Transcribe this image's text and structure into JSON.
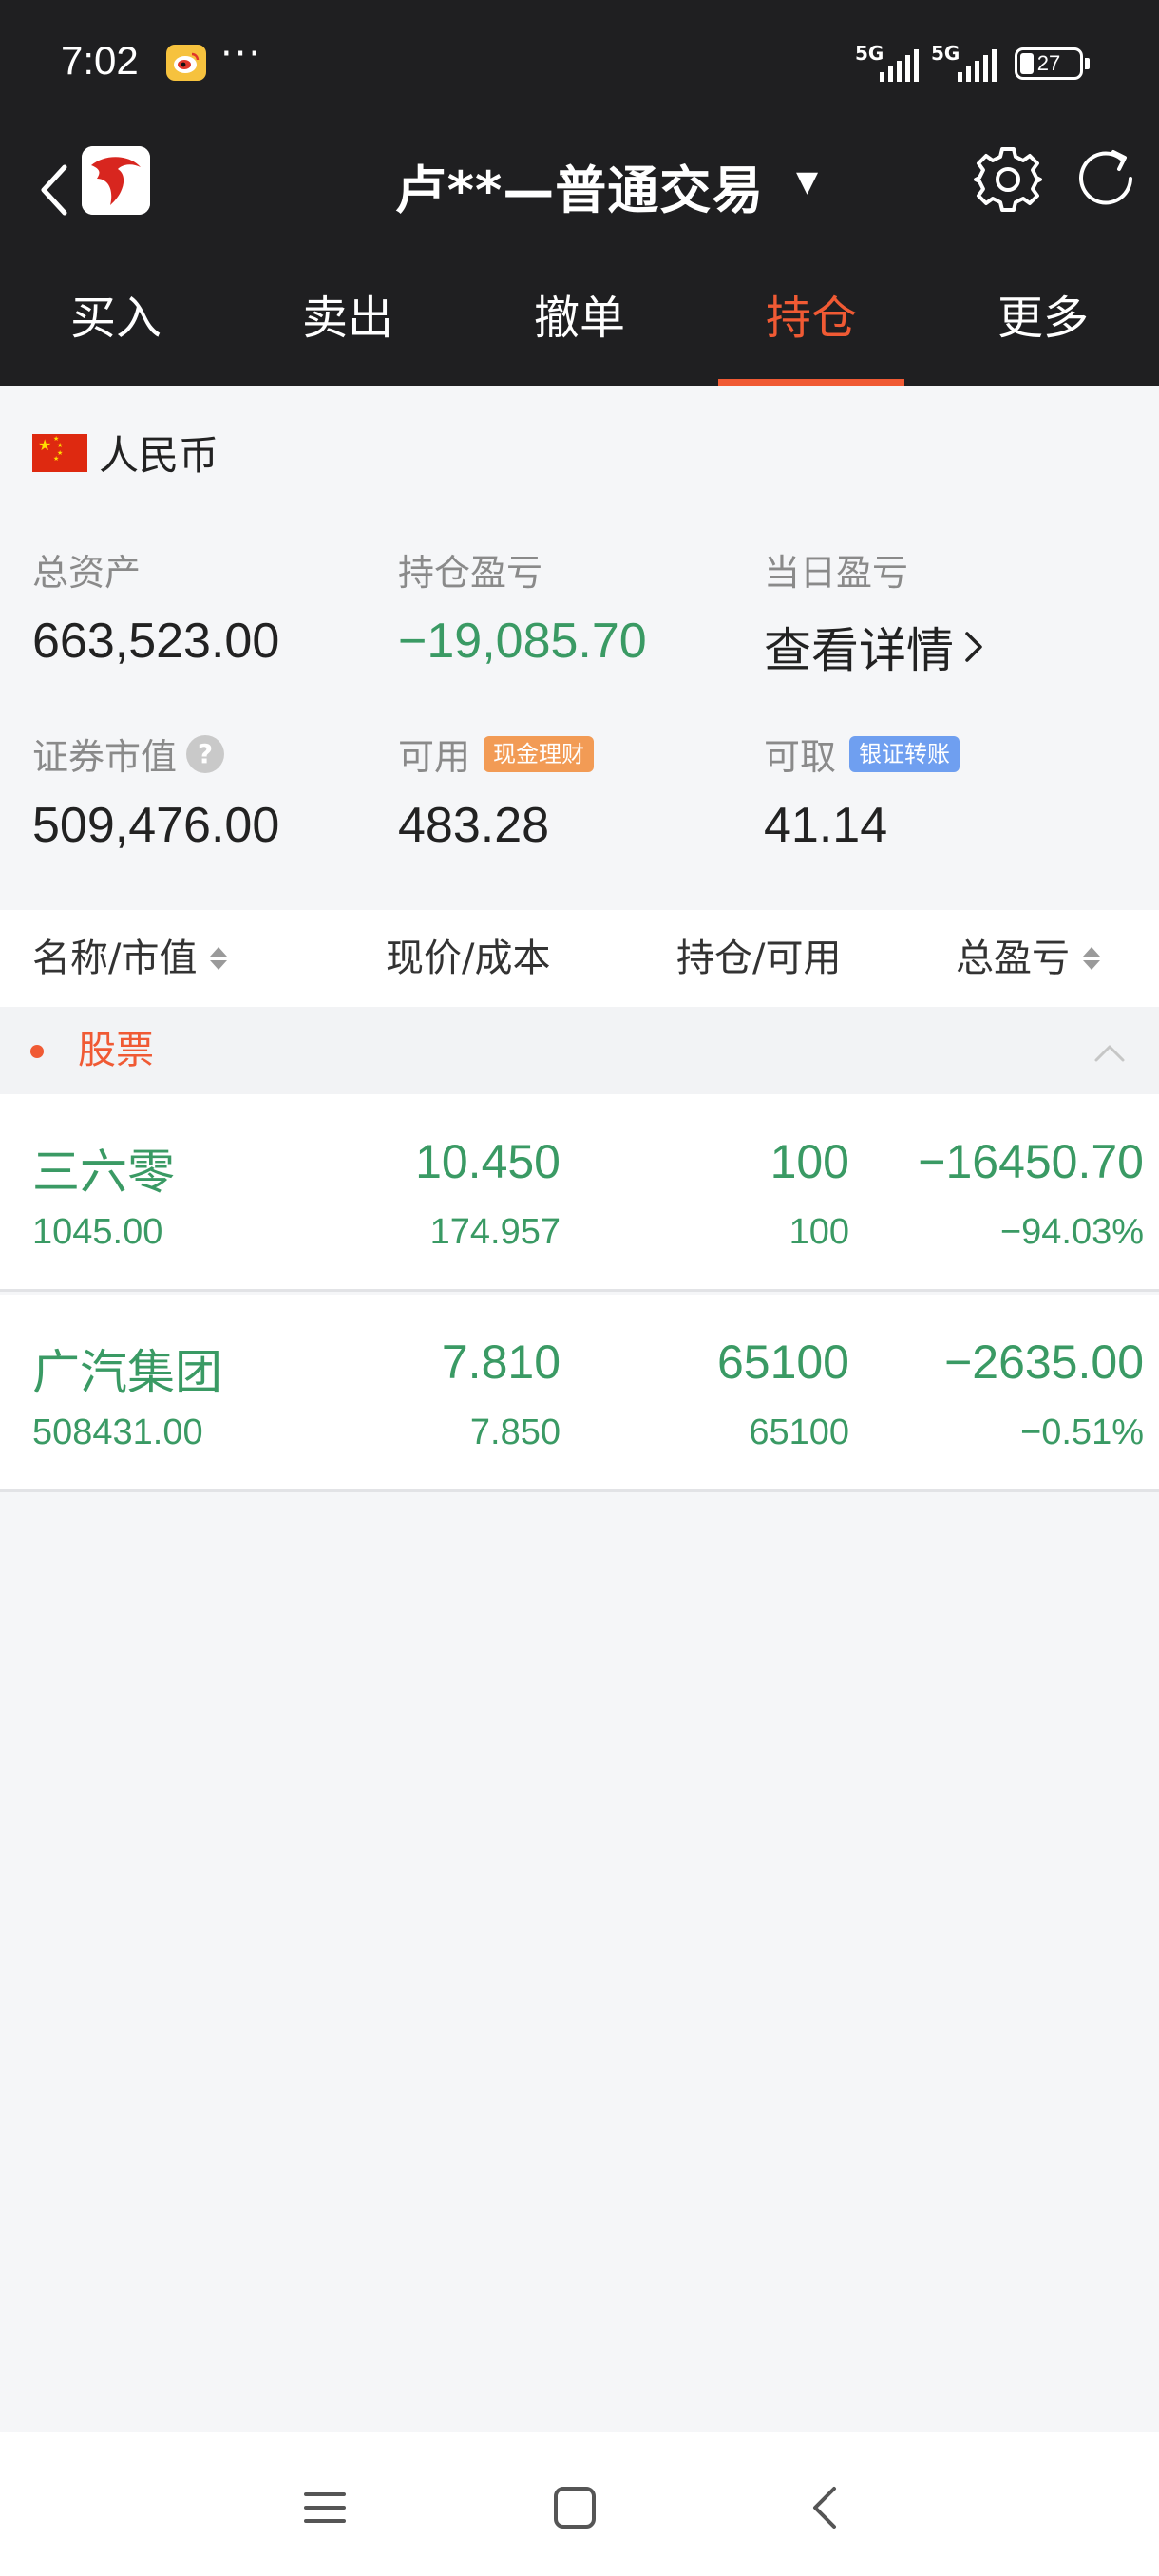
{
  "status_bar": {
    "time": "7:02",
    "more": "···",
    "network_1": "5G",
    "network_2": "5G",
    "battery": "27"
  },
  "header": {
    "title": "卢**—普通交易",
    "caret": "▼"
  },
  "tabs": [
    {
      "label": "买入",
      "active": false
    },
    {
      "label": "卖出",
      "active": false
    },
    {
      "label": "撤单",
      "active": false
    },
    {
      "label": "持仓",
      "active": true
    },
    {
      "label": "更多",
      "active": false
    }
  ],
  "account": {
    "currency": "人民币",
    "total_assets_label": "总资产",
    "total_assets": "663,523.00",
    "position_pnl_label": "持仓盈亏",
    "position_pnl": "−19,085.70",
    "daily_pnl_label": "当日盈亏",
    "daily_pnl_link": "查看详情",
    "market_value_label": "证券市值",
    "market_value": "509,476.00",
    "available_label": "可用",
    "available_badge": "现金理财",
    "available": "483.28",
    "withdrawable_label": "可取",
    "withdrawable_badge": "银证转账",
    "withdrawable": "41.14"
  },
  "table": {
    "headers": {
      "name": "名称/市值",
      "price": "现价/成本",
      "position": "持仓/可用",
      "pnl": "总盈亏"
    },
    "section": "股票",
    "rows": [
      {
        "name": "三六零",
        "market_value": "1045.00",
        "price": "10.450",
        "cost": "174.957",
        "position": "100",
        "available": "100",
        "pnl": "−16450.70",
        "pnl_pct": "−94.03%"
      },
      {
        "name": "广汽集团",
        "market_value": "508431.00",
        "price": "7.810",
        "cost": "7.850",
        "position": "65100",
        "available": "65100",
        "pnl": "−2635.00",
        "pnl_pct": "−0.51%"
      }
    ]
  },
  "colors": {
    "accent": "#f05a34",
    "loss_green": "#3a9a64",
    "header_bg": "#1f1f21"
  }
}
